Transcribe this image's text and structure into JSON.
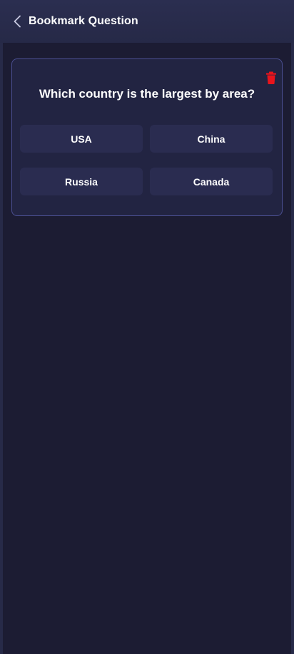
{
  "header": {
    "title": "Bookmark Question",
    "back_icon": "chevron-left-icon"
  },
  "question_card": {
    "question": "Which country is the largest by area?",
    "delete_icon": "trash-icon",
    "options": [
      {
        "label": "USA"
      },
      {
        "label": "China"
      },
      {
        "label": "Russia"
      },
      {
        "label": "Canada"
      }
    ]
  },
  "colors": {
    "header_bg": "#272a48",
    "content_bg": "#1c1c33",
    "card_border": "#4b4f92",
    "option_bg": "#2a2c50",
    "delete_red": "#e8141c"
  }
}
